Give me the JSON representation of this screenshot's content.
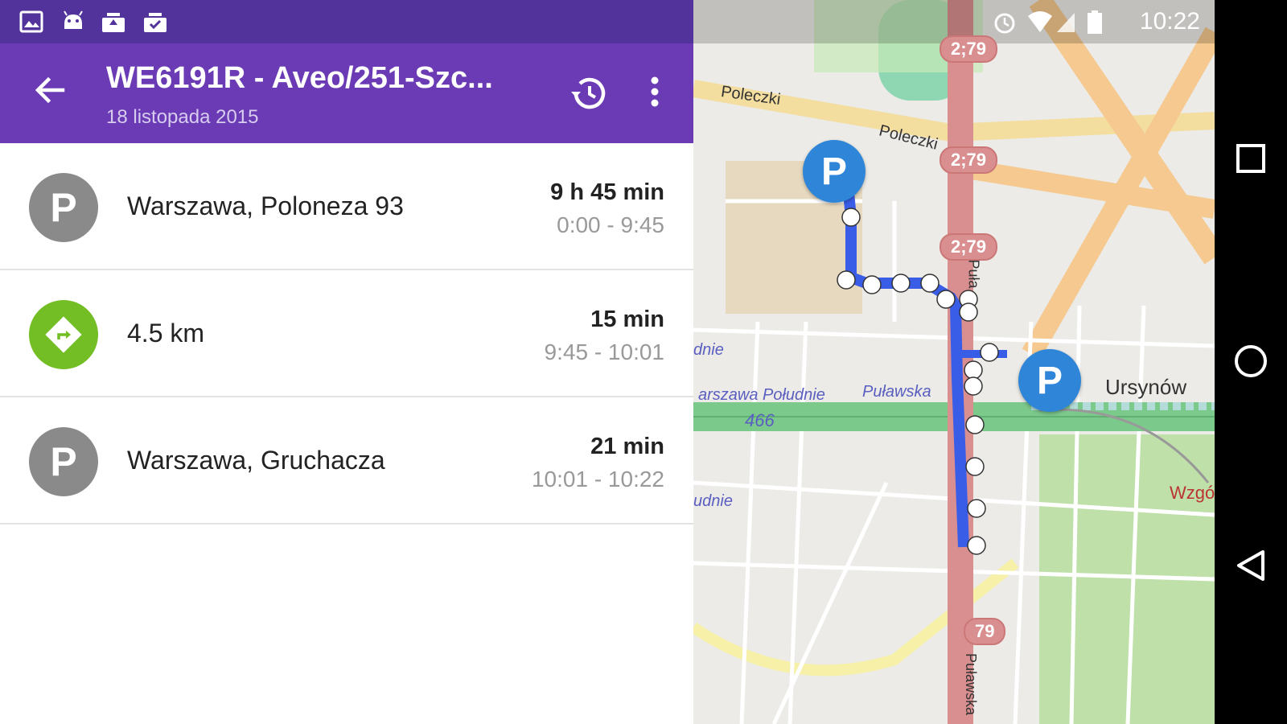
{
  "status_bar": {
    "time": "10:22",
    "left_icons": [
      "image-icon",
      "android-icon",
      "upload-icon",
      "checklist-icon"
    ],
    "right_icons": [
      "alarm-icon",
      "wifi-icon",
      "signal-icon",
      "battery-icon"
    ]
  },
  "app_bar": {
    "title": "WE6191R - Aveo/251-Szc...",
    "subtitle": "18 listopada 2015",
    "back_icon": "arrow-back-icon",
    "history_icon": "history-icon",
    "more_icon": "more-vert-icon"
  },
  "items": [
    {
      "type": "parking",
      "icon": "parking-icon",
      "label": "Warszawa, Poloneza 93",
      "duration": "9 h 45 min",
      "time_range": "0:00 - 9:45"
    },
    {
      "type": "drive",
      "icon": "route-icon",
      "label": "4.5 km",
      "duration": "15 min",
      "time_range": "9:45 - 10:01"
    },
    {
      "type": "parking",
      "icon": "parking-icon",
      "label": "Warszawa, Gruchacza",
      "duration": "21 min",
      "time_range": "10:01 - 10:22"
    }
  ],
  "map": {
    "labels": {
      "poleczki_1": "Poleczki",
      "poleczki_2": "Poleczki",
      "ursynow": "Ursynów",
      "wzgo": "Wzgó",
      "pulawska_1": "Puławska",
      "pulawska_2": "Puławska",
      "pula": "Puła",
      "warszawa_poludnie": "arszawa Południe",
      "route_466": "466",
      "dnie_1": "dnie",
      "dnie_2": "udnie"
    },
    "road_badges": [
      "2;79",
      "2;79",
      "2;79",
      "79"
    ],
    "pin_letter": "P",
    "colors": {
      "route": "#3a5de8",
      "pin": "#2f86d8",
      "road_main": "#d98f8f",
      "green_road": "#7cc98c",
      "park": "#c8e6b0"
    }
  },
  "nav_bar": {
    "recents_icon": "square-icon",
    "home_icon": "circle-icon",
    "back_icon": "triangle-back-icon"
  }
}
